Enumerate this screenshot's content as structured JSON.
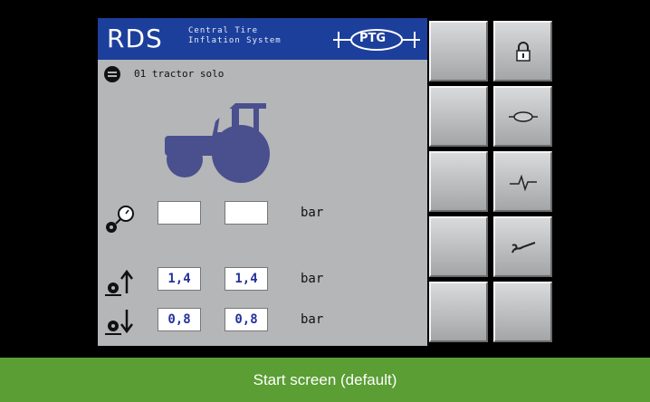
{
  "header": {
    "brand": "RDS",
    "subtitle": "Central Tire\nInflation System",
    "logo_text": "PTG"
  },
  "vehicle": {
    "name": "01 tractor solo"
  },
  "pressure_rows": [
    {
      "icon": "tire-gauge-icon",
      "left": "",
      "right": "",
      "unit": "bar"
    },
    {
      "icon": "tire-pressure-up-icon",
      "left": "1,4",
      "right": "1,4",
      "unit": "bar"
    },
    {
      "icon": "tire-pressure-down-icon",
      "left": "0,8",
      "right": "0,8",
      "unit": "bar"
    }
  ],
  "side_buttons": {
    "left_column": [
      "blank",
      "blank",
      "blank",
      "blank",
      "blank"
    ],
    "right_column": [
      "lock-icon",
      "ptg-logo-icon",
      "pulse-icon",
      "wrench-icon",
      "blank"
    ]
  },
  "caption": "Start screen (default)",
  "colors": {
    "header": "#1d3f9c",
    "panel": "#b4b6b8",
    "caption": "#5a9e34",
    "value_text": "#24329c"
  }
}
